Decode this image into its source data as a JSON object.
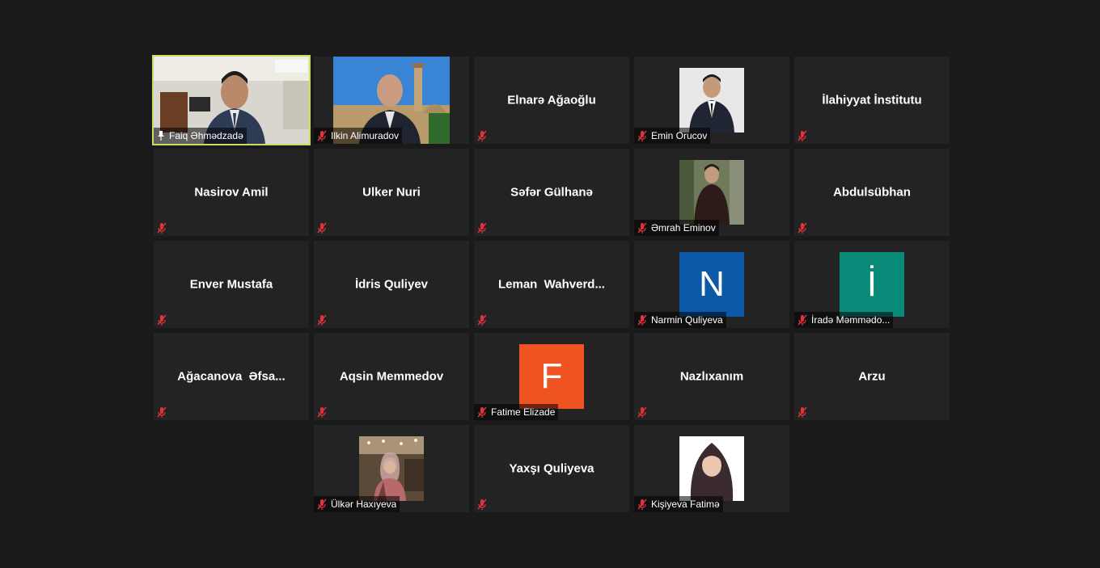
{
  "meeting": {
    "colors": {
      "background": "#1a1a1a",
      "tile": "#232323",
      "active_speaker_border": "#c8dd62",
      "muted_icon": "#e0323a"
    },
    "participants": [
      {
        "name": "Faiq Əhmədzadə",
        "video": "camera",
        "muted": false,
        "pinned": true,
        "active": true,
        "icon": "pin-icon"
      },
      {
        "name": "Ilkin Alimuradov",
        "video": "camera",
        "muted": true
      },
      {
        "name": "Elnarə Ağaoğlu",
        "video": "name",
        "muted": true
      },
      {
        "name": "Emin Orucov",
        "video": "photo",
        "muted": true
      },
      {
        "name": "İlahiyyat İnstitutu",
        "video": "name",
        "muted": true
      },
      {
        "name": "Nasirov Amil",
        "video": "name",
        "muted": true
      },
      {
        "name": "Ulker Nuri",
        "video": "name",
        "muted": true
      },
      {
        "name": "Səfər Gülhanə",
        "video": "name",
        "muted": true
      },
      {
        "name": "Əmrah Eminov",
        "video": "photo",
        "muted": true
      },
      {
        "name": "Abdulsübhan",
        "video": "name",
        "muted": true
      },
      {
        "name": "Enver Mustafa",
        "video": "name",
        "muted": true
      },
      {
        "name": "İdris Quliyev",
        "video": "name",
        "muted": true
      },
      {
        "name": "Leman  Wahverd...",
        "video": "name",
        "muted": true
      },
      {
        "name": "Narmin Quliyeva",
        "video": "letter",
        "letter": "N",
        "letter_color": "#0a5aa7",
        "muted": true
      },
      {
        "name": "İradə Məmmədo...",
        "video": "letter",
        "letter": "İ",
        "letter_color": "#0a8a78",
        "muted": true
      },
      {
        "name": "Ağacanova  Əfsa...",
        "video": "name",
        "muted": true
      },
      {
        "name": "Aqsin Memmedov",
        "video": "name",
        "muted": true
      },
      {
        "name": "Fatime Elizade",
        "video": "letter",
        "letter": "F",
        "letter_color": "#f05322",
        "muted": true
      },
      {
        "name": "Nazlıxanım",
        "video": "name",
        "muted": true
      },
      {
        "name": "Arzu",
        "video": "name",
        "muted": true
      },
      {
        "name": "Ülkər Haxıyeva",
        "video": "photo",
        "muted": true
      },
      {
        "name": "Yaxşı Quliyeva",
        "video": "name",
        "muted": true
      },
      {
        "name": "Kişiyeva Fatimə",
        "video": "photo",
        "muted": true
      }
    ]
  }
}
